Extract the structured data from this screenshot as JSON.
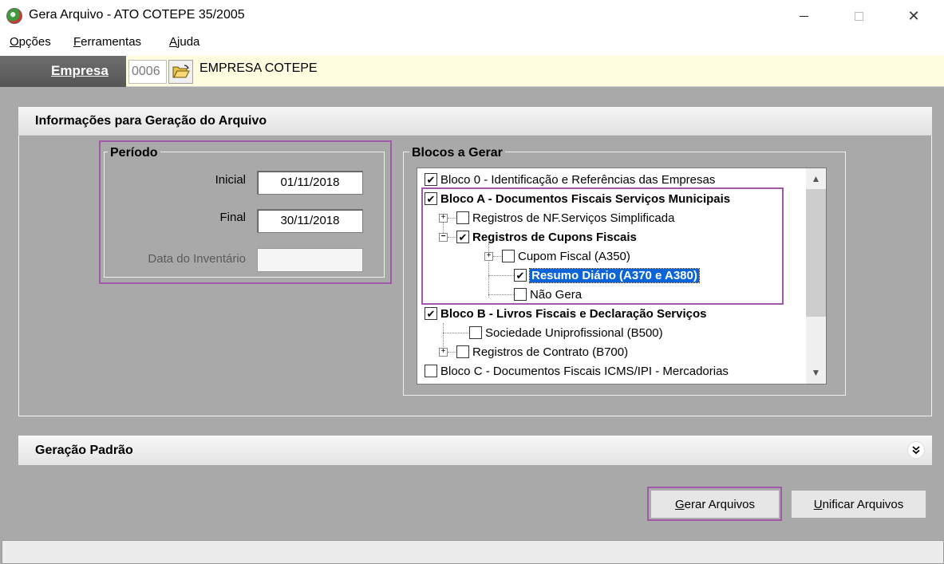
{
  "window": {
    "title": "Gera Arquivo - ATO COTEPE 35/2005",
    "controls": {
      "minimize": "—",
      "maximize": "☐",
      "close": "✕"
    }
  },
  "menu": [
    {
      "label": "Opções",
      "underline": "O",
      "rest": "pções"
    },
    {
      "label": "Ferramentas",
      "underline": "F",
      "rest": "erramentas"
    },
    {
      "label": "Ajuda",
      "underline": "A",
      "rest": "juda"
    }
  ],
  "empresa": {
    "label": "Empresa",
    "code": "0006",
    "name": "EMPRESA COTEPE"
  },
  "info_panel": {
    "title": "Informações para Geração do Arquivo",
    "periodo": {
      "title": "Período",
      "inicial_label": "Inicial",
      "inicial_value": "01/11/2018",
      "final_label": "Final",
      "final_value": "30/11/2018",
      "inventario_label": "Data do Inventário",
      "inventario_value": ""
    },
    "blocos": {
      "title": "Blocos a Gerar",
      "items": [
        {
          "label": "Bloco 0 - Identificação e Referências das Empresas",
          "checked": true
        },
        {
          "label": "Bloco A - Documentos Fiscais Serviços Municipais",
          "checked": true
        },
        {
          "label": "Registros de NF.Serviços Simplificada",
          "checked": false,
          "expander": "+"
        },
        {
          "label": "Registros de Cupons Fiscais",
          "checked": true,
          "expander": "−"
        },
        {
          "label": "Cupom Fiscal  (A350)",
          "checked": false,
          "expander": "+"
        },
        {
          "label": "Resumo Diário  (A370 e A380)",
          "checked": true
        },
        {
          "label": "Não Gera",
          "checked": false
        },
        {
          "label": "Bloco B - Livros Fiscais e Declaração Serviços",
          "checked": true
        },
        {
          "label": "Sociedade Uniprofissional  (B500)",
          "checked": false
        },
        {
          "label": "Registros de Contrato  (B700)",
          "checked": false,
          "expander": "+"
        },
        {
          "label": "Bloco C - Documentos Fiscais ICMS/IPI - Mercadorias",
          "checked": false
        }
      ]
    }
  },
  "geracao": {
    "title": "Geração Padrão",
    "toggle_icon": "»"
  },
  "buttons": {
    "gerar": {
      "underline": "G",
      "rest": "erar Arquivos"
    },
    "unificar": {
      "underline": "U",
      "rest": "nificar Arquivos"
    }
  },
  "colors": {
    "highlight": "#9e5aa6",
    "selection": "#0a64d8",
    "empresa_bg": "#fffde0",
    "body_bg": "#a9a9a9"
  }
}
